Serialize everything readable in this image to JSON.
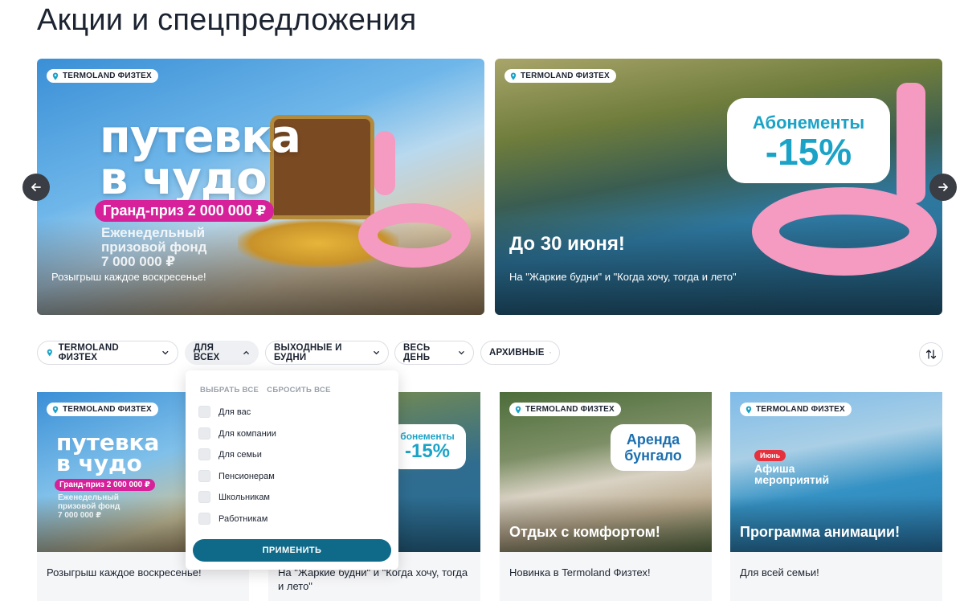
{
  "page": {
    "title": "Акции и спецпредложения"
  },
  "hero": [
    {
      "location": "TERMOLAND ФИЗТЕХ",
      "art_title_1": "путевка",
      "art_title_2": "в чудо",
      "grand_prize": "Гранд-приз 2 000 000 ₽",
      "weekly_fund_1": "Еженедельный",
      "weekly_fund_2": "призовой фонд",
      "weekly_fund_3": "7 000 000 ₽",
      "caption": "Розыгрыш каждое воскресенье!"
    },
    {
      "location": "TERMOLAND ФИЗТЕХ",
      "promo_line1": "Абонементы",
      "promo_line2": "-15%",
      "headline": "До 30 июня!",
      "caption": "На \"Жаркие будни\" и \"Когда хочу, тогда и лето\""
    }
  ],
  "filters": {
    "location": "TERMOLAND ФИЗТЕХ",
    "audience": "ДЛЯ ВСЕХ",
    "days": "ВЫХОДНЫЕ И БУДНИ",
    "time": "ВЕСЬ ДЕНЬ",
    "archive": "АРХИВНЫЕ"
  },
  "dropdown": {
    "select_all": "ВЫБРАТЬ ВСЕ",
    "reset_all": "СБРОСИТЬ ВСЕ",
    "options": [
      "Для вас",
      "Для компании",
      "Для семьи",
      "Пенсионерам",
      "Школьникам",
      "Работникам"
    ],
    "apply": "ПРИМЕНИТЬ"
  },
  "cards": [
    {
      "location": "TERMOLAND ФИЗТЕХ",
      "art_title_1": "путевка",
      "art_title_2": "в чудо",
      "grand_prize": "Гранд-приз 2 000 000 ₽",
      "weekly_fund_1": "Еженедельный",
      "weekly_fund_2": "призовой фонд",
      "weekly_fund_3": "7 000 000 ₽",
      "text": "Розыгрыш каждое воскресенье!"
    },
    {
      "promo_line1": "бонементы",
      "promo_line2": "-15%",
      "text": "На \"Жаркие будни\" и \"Когда хочу, тогда и лето\""
    },
    {
      "location": "TERMOLAND ФИЗТЕХ",
      "tag_line1": "Аренда",
      "tag_line2": "бунгало",
      "overlay_title": "Отдых с комфортом!",
      "text": "Новинка в Termoland Физтех!"
    },
    {
      "location": "TERMOLAND ФИЗТЕХ",
      "season": "Июнь",
      "afisha_line1": "Афиша",
      "afisha_line2": "мероприятий",
      "overlay_title": "Программа анимации!",
      "text": "Для всей семьи!"
    }
  ],
  "colors": {
    "primary_button": "#0f6a89",
    "promo_cyan": "#1ba3c7",
    "prize_magenta": "#d6219a",
    "pin_teal": "#1ba3c7"
  },
  "icons": {
    "location": "location-pin-icon",
    "chevron": "chevron-down-icon",
    "chevron_open": "chevron-up-icon",
    "sort": "sort-arrows-icon",
    "prev": "arrow-left-icon",
    "next": "arrow-right-icon"
  }
}
